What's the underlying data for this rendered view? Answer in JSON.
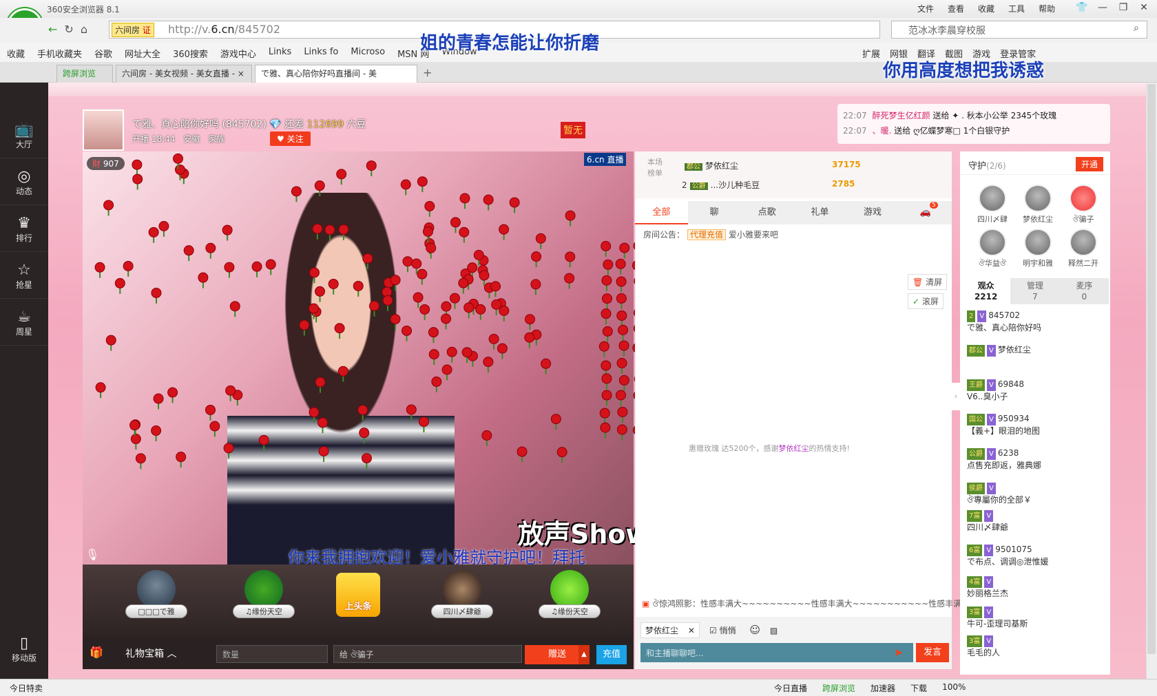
{
  "browser": {
    "title": "360安全浏览器 8.1",
    "menus": [
      "文件",
      "查看",
      "收藏",
      "工具",
      "帮助"
    ],
    "url_prefix": "http://v.",
    "url_host": "6.cn",
    "url_path": "/845702",
    "site_badge": "六间房",
    "site_badge_tag": "证",
    "search_text": "范冰冰李晨穿校服",
    "bookmarks": [
      "收藏",
      "手机收藏夹",
      "谷歌",
      "网址大全",
      "360搜索",
      "游戏中心",
      "Links",
      "Links fo",
      "Microso",
      "MSN 网",
      "Window"
    ],
    "tools": [
      "扩展",
      "网银",
      "翻译",
      "截图",
      "游戏",
      "登录管家"
    ],
    "tabs": [
      {
        "label": "跨屏浏览"
      },
      {
        "label": "六间房 - 美女视频 - 美女直播 - ×"
      },
      {
        "label": "で雅、真心陪你好吗直播间 - 美"
      }
    ]
  },
  "overlays": {
    "line1": "姐的青春怎能让你折磨",
    "line2": "你用高度想把我诱惑"
  },
  "sidebar": {
    "items": [
      {
        "label": "大厅",
        "icon": "tv-icon",
        "glyph": "📺"
      },
      {
        "label": "动态",
        "icon": "compass-icon",
        "glyph": "◎"
      },
      {
        "label": "排行",
        "icon": "crown-icon",
        "glyph": "♛"
      },
      {
        "label": "抢星",
        "icon": "star-icon",
        "glyph": "☆"
      },
      {
        "label": "周星",
        "icon": "cup-icon",
        "glyph": "☕"
      }
    ],
    "mobile": "移动版"
  },
  "room": {
    "name": "で雅、真心陪你好吗 (845702)",
    "gap_label": "还差",
    "gap_value": "112699",
    "gap_unit": "六豆",
    "start_label": "开播 18:44",
    "location": "安徽",
    "family_label": "家族",
    "follow": "关注",
    "hot_flag": "暂无",
    "wealth": "907",
    "video_logo": "6.cn 直播",
    "show_logo": "放声Show唱",
    "marquee": "你来我拥抱欢迎！爱小雅就守护吧！拜托"
  },
  "ticker": [
    {
      "time": "22:07",
      "user": "醉死梦生亿红颜",
      "text": "送给 ✦ . 秋本小公举 2345个玫瑰"
    },
    {
      "time": "22:07",
      "user": "、暖.",
      "text": "送给 ღ亿蝶梦寒□ 1个白银守护"
    }
  ],
  "gift_guards": [
    {
      "name": "□□□で雅"
    },
    {
      "name": "♫缘份天空"
    },
    {
      "name": "四川〆肆爺"
    },
    {
      "name": "♫缘份天空"
    }
  ],
  "headline": "上头条",
  "gift_controls": {
    "box": "礼物宝箱",
    "qty_placeholder": "数量",
    "to_label": "给 ঔ骗子",
    "send": "赠送",
    "recharge": "充值"
  },
  "rank": {
    "label": "本场榜单",
    "rows": [
      {
        "no": "",
        "level": "郡公",
        "name": "梦依红尘",
        "value": "37175"
      },
      {
        "no": "2",
        "level": "公爵",
        "name": "...沙儿种毛豆",
        "value": "2785"
      }
    ]
  },
  "chat": {
    "tabs": [
      {
        "label": "全部",
        "on": true
      },
      {
        "label": "聊",
        "on": false
      },
      {
        "label": "点歌",
        "on": false
      },
      {
        "label": "礼单",
        "on": false
      },
      {
        "label": "游戏",
        "on": false
      },
      {
        "label": "🚗",
        "on": false
      }
    ],
    "tab_badge": "5",
    "notice_label": "房间公告：",
    "notice_tag": "代理充值",
    "notice_text": "爱小雅要来吧",
    "clear": "清屏",
    "scroll": "滚屏",
    "thanks_pre": "惠赠玫瑰 达5200个，感谢",
    "thanks_user": "梦依红尘",
    "thanks_post": "的热情支持!",
    "message": "ঔ惊鸿照影：性感丰满大~~~~~~~~~~性感丰满大~~~~~~~~~~~性感丰满大",
    "target": "梦依红尘",
    "quiet": "悄悄",
    "input_placeholder": "和主播聊聊吧...",
    "post": "发言"
  },
  "guards": {
    "title": "守护",
    "count": "(2/6)",
    "open": "开通",
    "members": [
      "四川〆肆",
      "梦依红尘",
      "ঔ骗子",
      "ঔ华益ঔ",
      "明宇和雅",
      "释然二开"
    ]
  },
  "audience_tabs": [
    {
      "label": "观众",
      "count": "2212",
      "on": true
    },
    {
      "label": "管理",
      "count": "7",
      "on": false
    },
    {
      "label": "麦序",
      "count": "0",
      "on": false
    }
  ],
  "audience": [
    {
      "level": "2",
      "name": "845702",
      "sub": "で雅、真心陪你好吗"
    },
    {
      "level": "郡公",
      "name": "梦依红尘",
      "sub": ""
    },
    {
      "level": "王爵",
      "name": "69848",
      "sub": "V6..臭小子"
    },
    {
      "level": "国公",
      "name": "950934",
      "sub": "【義+】眼泪的地图"
    },
    {
      "level": "公爵",
      "name": "6238",
      "sub": "点售充即返，雅典娜"
    },
    {
      "level": "侯爵",
      "name": "",
      "sub": "ঔ專屬你的全部￥"
    },
    {
      "level": "7富",
      "name": "",
      "sub": "四川〆肆爺"
    },
    {
      "level": "6富",
      "name": "9501075",
      "sub": "で布点、调调◎泄惟媛"
    },
    {
      "level": "4富",
      "name": "",
      "sub": "妙丽格兰杰"
    },
    {
      "level": "3富",
      "name": "",
      "sub": "牛可-歪理司基斯"
    },
    {
      "level": "3富",
      "name": "",
      "sub": "毛毛的人"
    }
  ],
  "statusbar": {
    "left": "今日特卖",
    "items": [
      "今日直播",
      "跨屏浏览",
      "加速器",
      "下载",
      "100%"
    ]
  }
}
